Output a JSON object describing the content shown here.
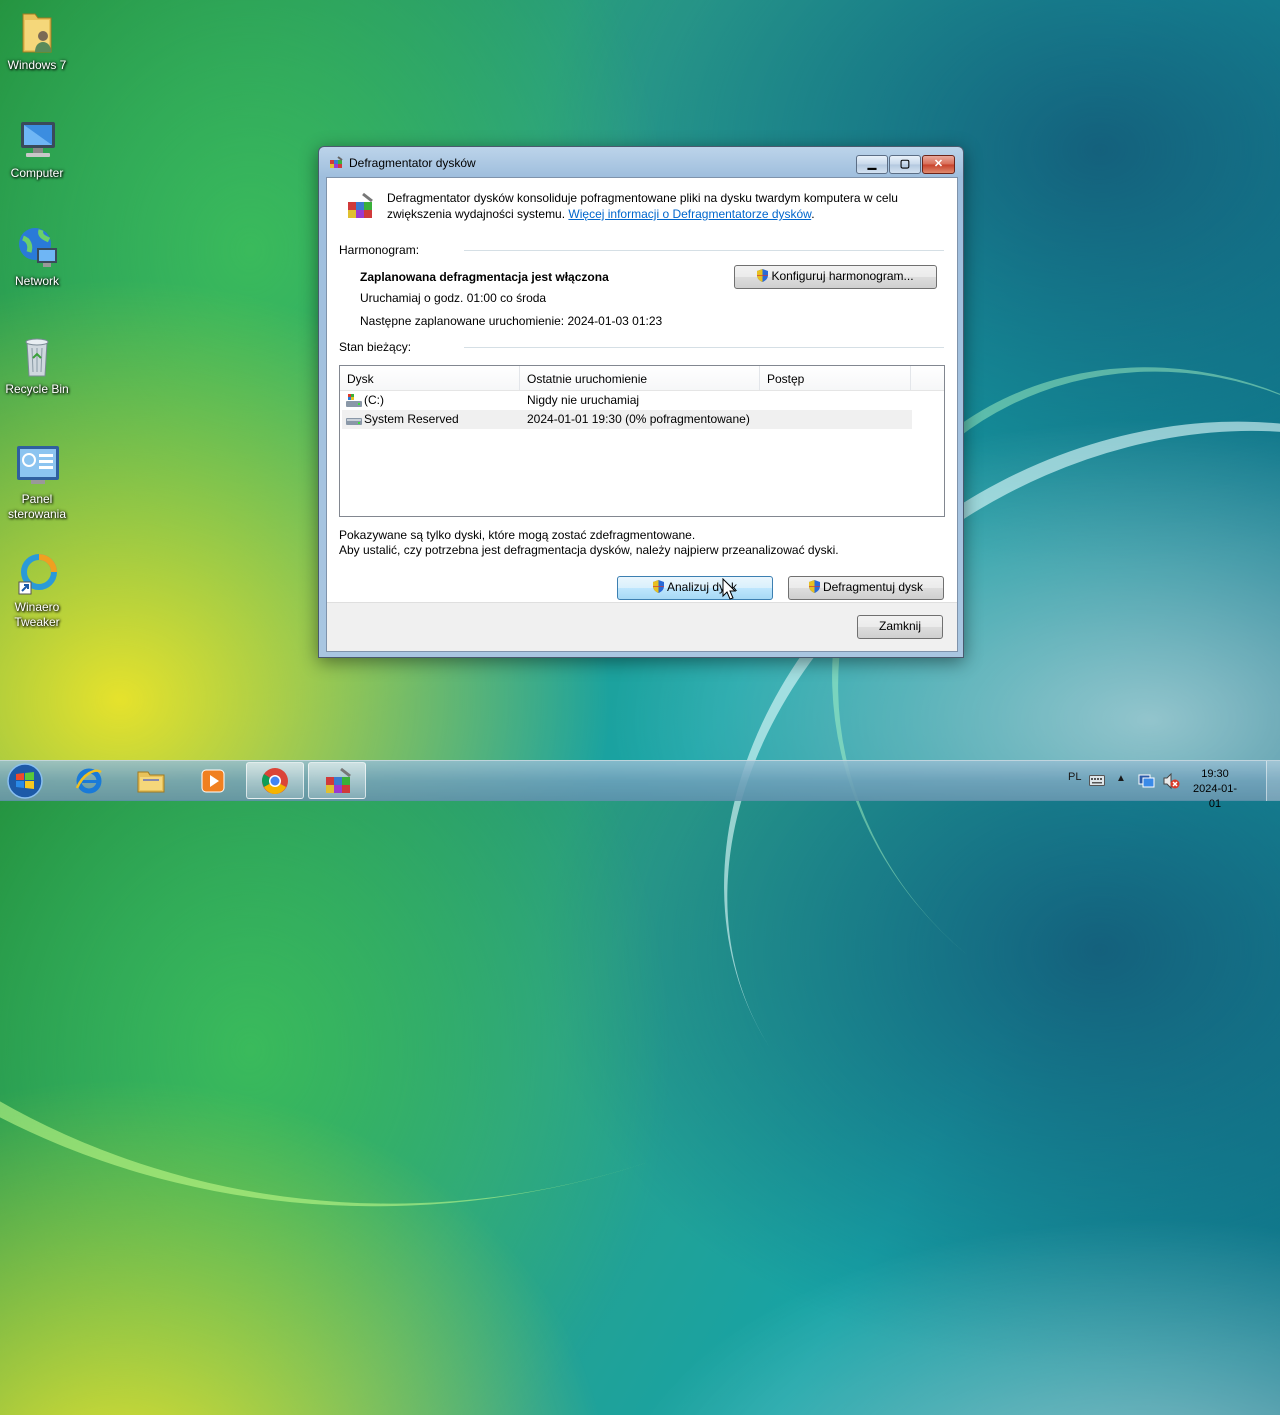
{
  "desktop": {
    "icons": [
      {
        "label": "Windows 7"
      },
      {
        "label": "Computer"
      },
      {
        "label": "Network"
      },
      {
        "label": "Recycle Bin"
      },
      {
        "label": "Panel sterowania"
      },
      {
        "label": "Winaero Tweaker"
      }
    ]
  },
  "window": {
    "title": "Defragmentator dysków",
    "intro_text": "Defragmentator dysków konsoliduje pofragmentowane pliki na dysku twardym komputera w celu zwiększenia wydajności systemu.",
    "intro_link": "Więcej informacji o Defragmentatorze dysków",
    "intro_link_suffix": ".",
    "schedule": {
      "section_label": "Harmonogram:",
      "status": "Zaplanowana defragmentacja jest włączona",
      "run_at": "Uruchamiaj o godz. 01:00 co środa",
      "next_run": "Następne zaplanowane uruchomienie: 2024-01-03 01:23",
      "configure_button": "Konfiguruj harmonogram..."
    },
    "current_status": {
      "section_label": "Stan bieżący:",
      "columns": [
        "Dysk",
        "Ostatnie uruchomienie",
        "Postęp"
      ],
      "rows": [
        {
          "disk": "(C:)",
          "last_run": "Nigdy nie uruchamiaj",
          "progress": ""
        },
        {
          "disk": "System Reserved",
          "last_run": "2024-01-01 19:30 (0% pofragmentowane)",
          "progress": ""
        }
      ]
    },
    "note_line1": "Pokazywane są tylko dyski, które mogą zostać zdefragmentowane.",
    "note_line2": "Aby ustalić, czy potrzebna jest defragmentacja dysków, należy najpierw przeanalizować dyski.",
    "analyze_button": "Analizuj dysk",
    "defrag_button": "Defragmentuj dysk",
    "close_button": "Zamknij"
  },
  "taskbar": {
    "language": "PL",
    "time": "19:30",
    "date": "2024-01-01"
  }
}
